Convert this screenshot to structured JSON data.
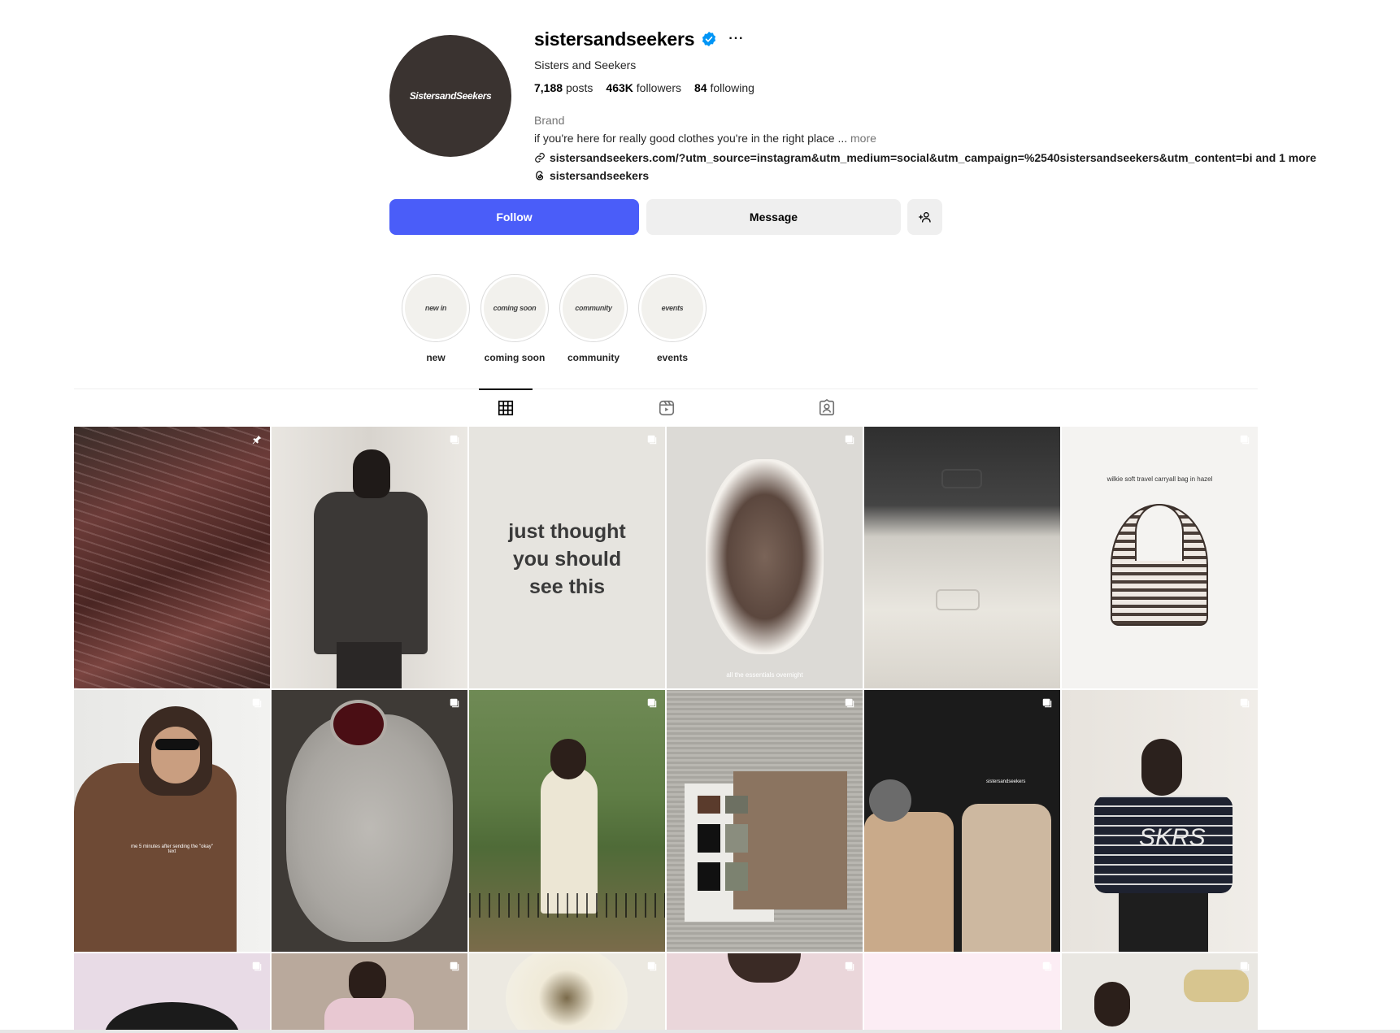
{
  "profile": {
    "avatar_text": "SistersandSeekers",
    "username": "sistersandseekers",
    "full_name": "Sisters and Seekers",
    "posts_count": "7,188",
    "posts_label": "posts",
    "followers_count": "463K",
    "followers_label": "followers",
    "following_count": "84",
    "following_label": "following",
    "category": "Brand",
    "bio": "if you're here for really good clothes you're in the right place ...",
    "bio_more": "more",
    "link": "sistersandseekers.com/?utm_source=instagram&utm_medium=social&utm_campaign=%2540sistersandseekers&utm_content=bi and 1 more",
    "threads_handle": "sistersandseekers"
  },
  "actions": {
    "follow": "Follow",
    "message": "Message"
  },
  "highlights": [
    {
      "cover_text": "new in",
      "label": "new"
    },
    {
      "cover_text": "coming soon",
      "label": "coming soon"
    },
    {
      "cover_text": "community",
      "label": "community"
    },
    {
      "cover_text": "events",
      "label": "events"
    }
  ],
  "tabs": [
    "posts-grid-icon",
    "reels-icon",
    "tagged-icon"
  ],
  "posts": [
    {
      "caption_overlay": ""
    },
    {
      "caption_overlay": ""
    },
    {
      "caption_overlay": "just thought you should see this"
    },
    {
      "caption_overlay": "all the essentials overnight"
    },
    {
      "caption_overlay": ""
    },
    {
      "caption_overlay": "wilkie soft travel carryall bag in hazel"
    },
    {
      "caption_overlay": "me 5 minutes after sending the \"okay\" text"
    },
    {
      "caption_overlay": ""
    },
    {
      "caption_overlay": ""
    },
    {
      "caption_overlay": ""
    },
    {
      "caption_overlay": "sistersandseekers"
    },
    {
      "caption_overlay": "SKRS"
    }
  ],
  "colors": {
    "follow_button": "#4a5df9",
    "verified_badge": "#0095f6",
    "avatar_bg": "#3a3330"
  }
}
